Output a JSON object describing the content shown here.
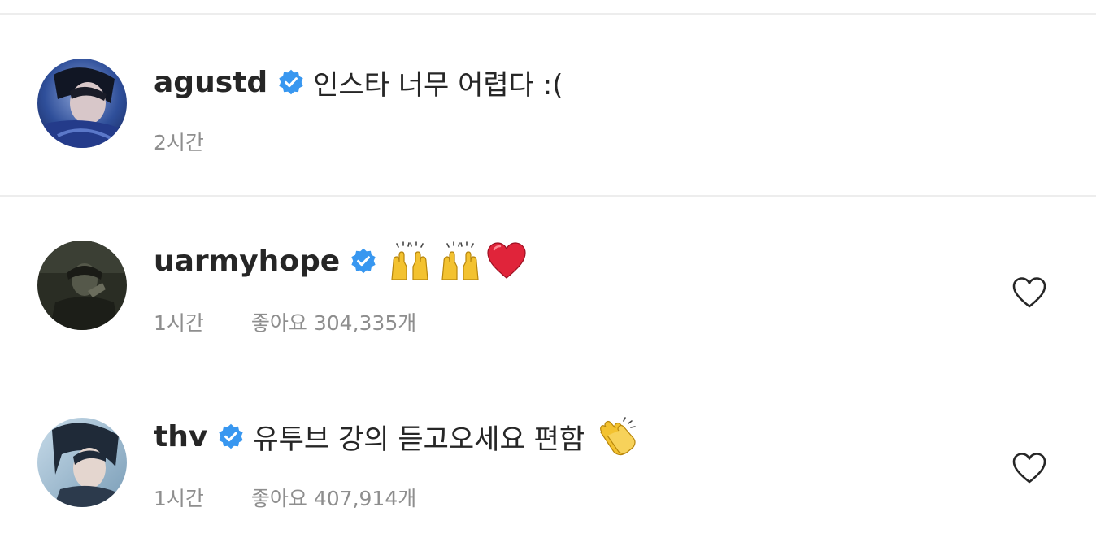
{
  "comments": [
    {
      "username": "agustd",
      "text": "인스타 너무 어렵다 :(",
      "time": "2시간",
      "likes": "",
      "verified_color": "#3897f0"
    },
    {
      "username": "uarmyhope",
      "text": "",
      "emojis": [
        "raising-hands",
        "raising-hands",
        "red-heart"
      ],
      "time": "1시간",
      "likes": "좋아요 304,335개",
      "verified_color": "#3897f0"
    },
    {
      "username": "thv",
      "text": "유투브 강의 듣고오세요 편함",
      "emojis": [
        "clapping-hands"
      ],
      "time": "1시간",
      "likes": "좋아요 407,914개",
      "verified_color": "#3897f0"
    }
  ],
  "icons": {
    "verified": "verified-badge-icon",
    "like": "heart-outline-icon"
  },
  "colors": {
    "text": "#262626",
    "meta": "#8e8e8e",
    "divider": "#ededed"
  }
}
